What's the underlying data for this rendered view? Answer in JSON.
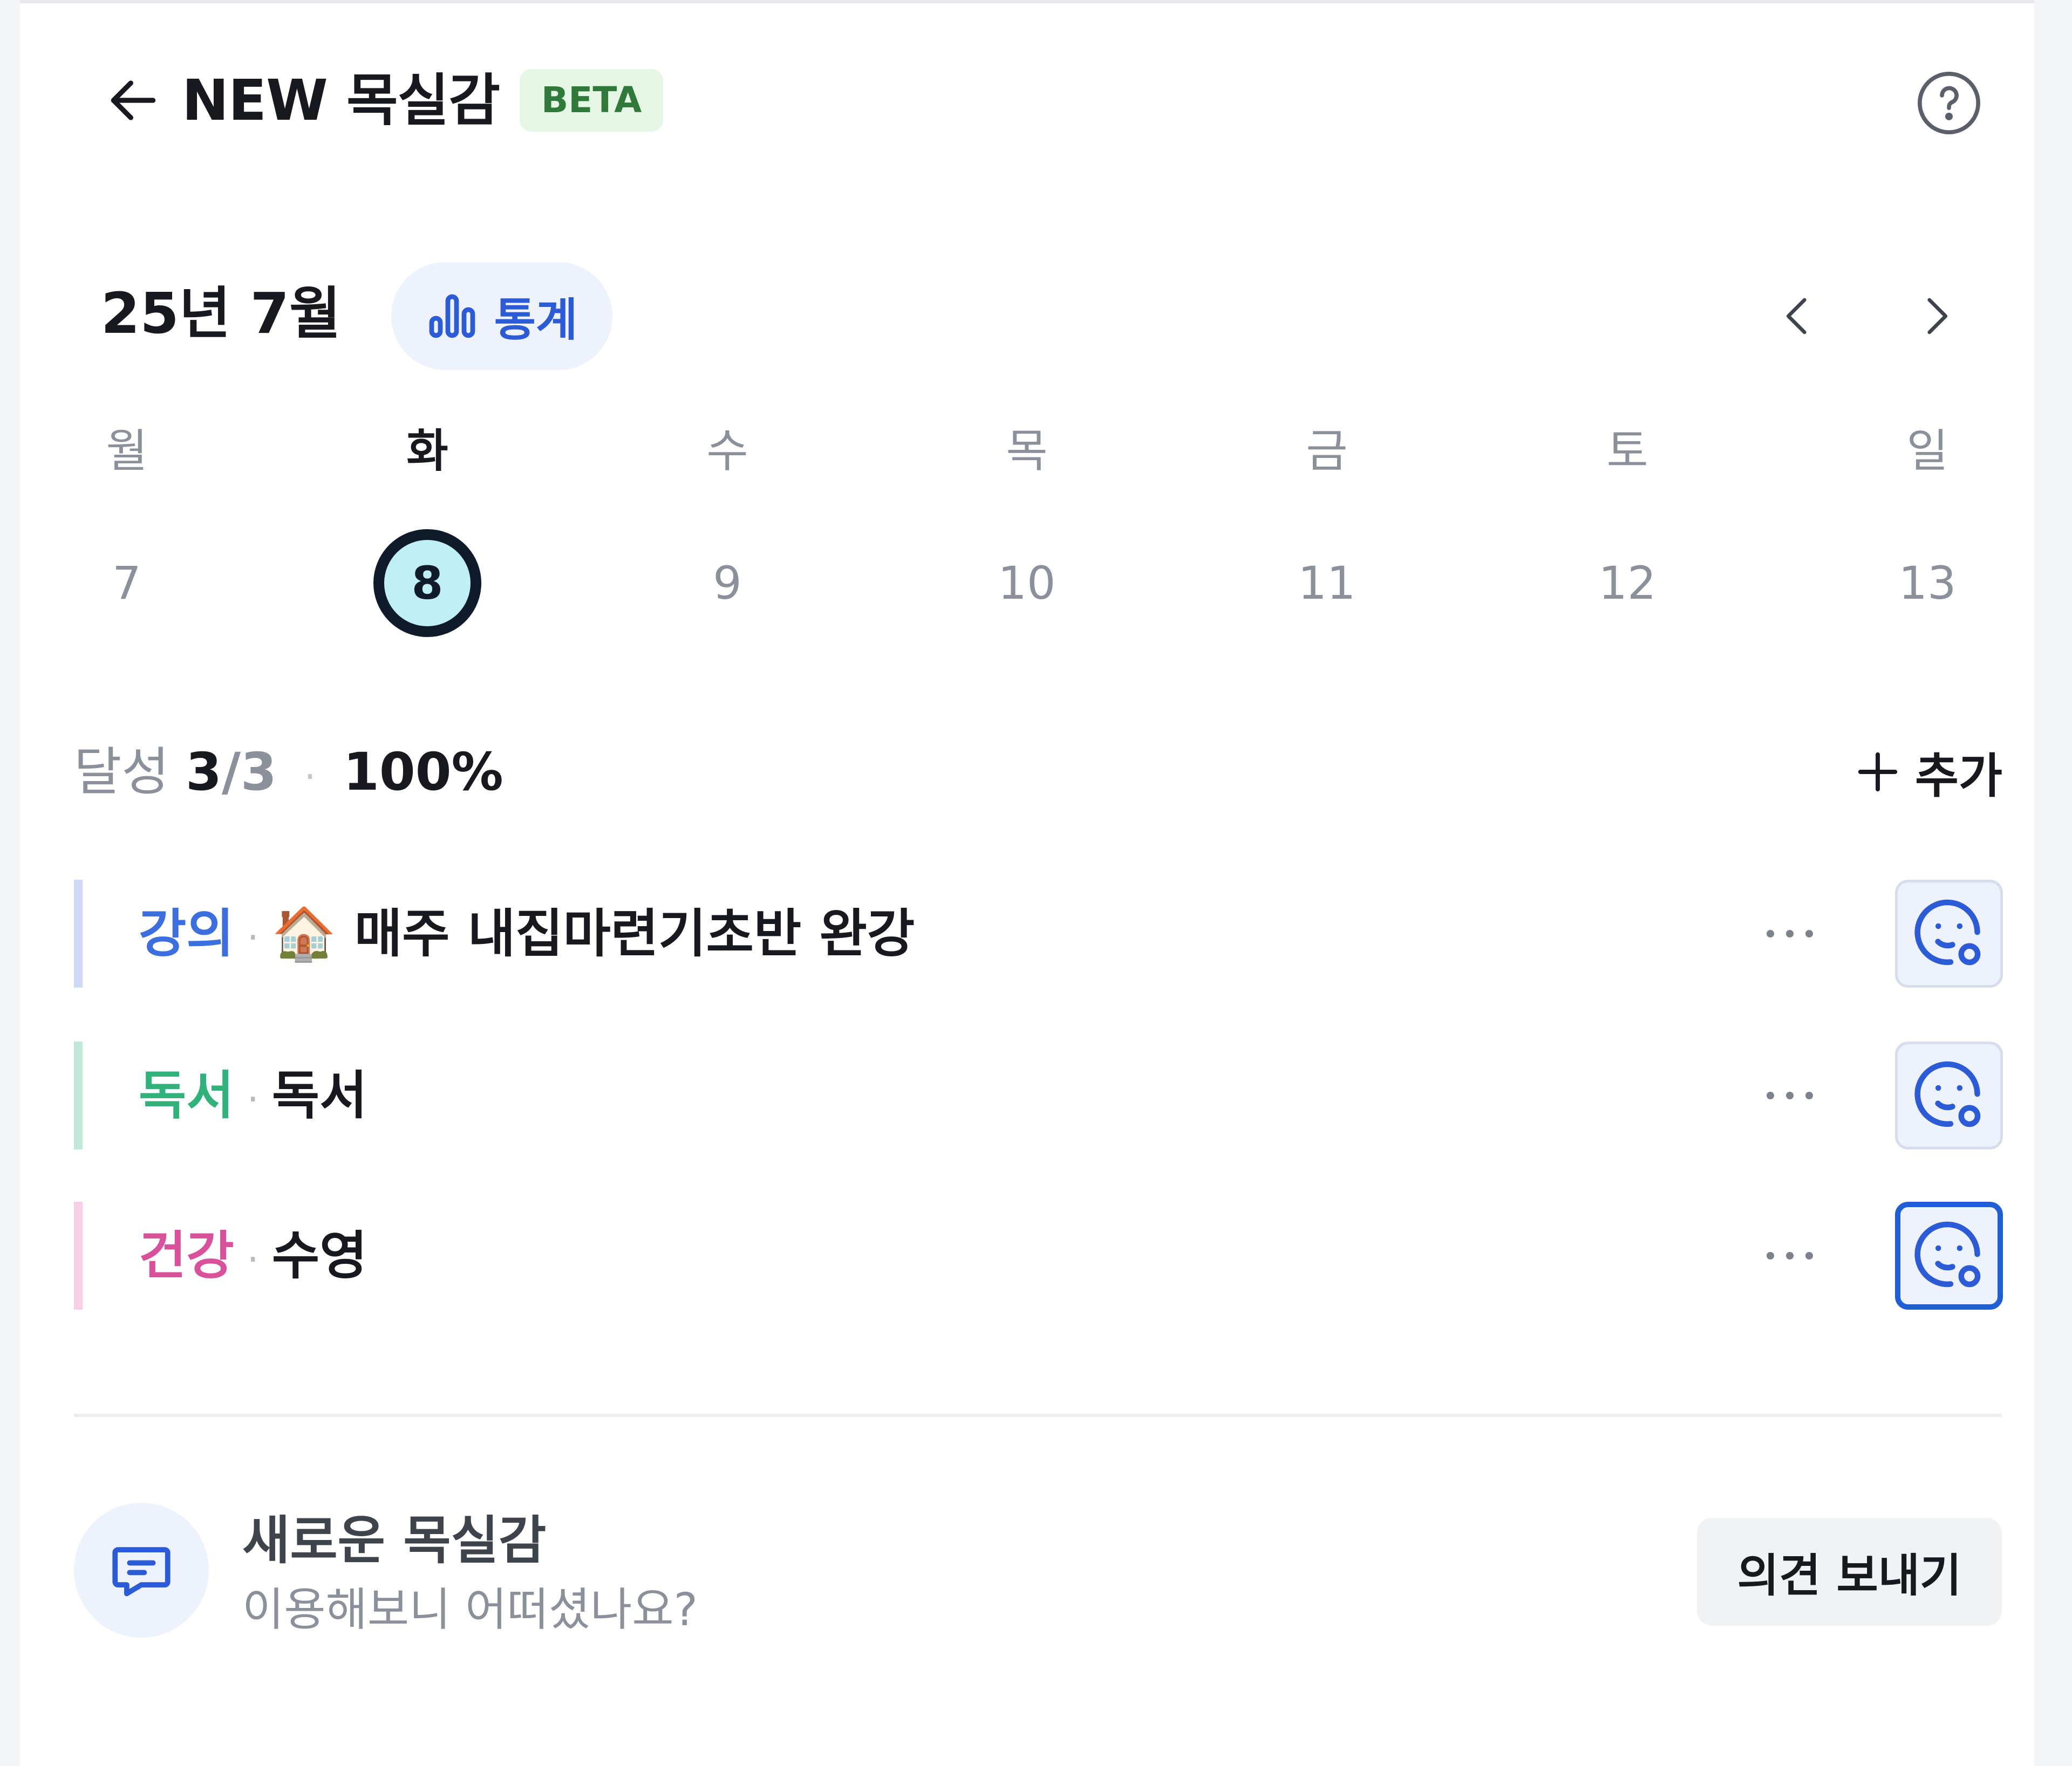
{
  "header": {
    "title": "NEW 목실감",
    "badge": "BETA"
  },
  "calendar": {
    "month_label": "25년 7월",
    "stats_label": "통계",
    "days": [
      {
        "name": "월",
        "num": "7",
        "selected": false
      },
      {
        "name": "화",
        "num": "8",
        "selected": true
      },
      {
        "name": "수",
        "num": "9",
        "selected": false
      },
      {
        "name": "목",
        "num": "10",
        "selected": false
      },
      {
        "name": "금",
        "num": "11",
        "selected": false
      },
      {
        "name": "토",
        "num": "12",
        "selected": false
      },
      {
        "name": "일",
        "num": "13",
        "selected": false
      }
    ]
  },
  "achievement": {
    "label": "달성",
    "count": "3",
    "total": "/3",
    "separator": "·",
    "percent": "100%"
  },
  "add_label": "추가",
  "goals": [
    {
      "category": "강의",
      "emoji": "🏠",
      "title": "매주 내집마련기초반 완강",
      "category_color": "#3b6fe0",
      "bar_color": "#cdd9f7"
    },
    {
      "category": "독서",
      "emoji": "",
      "title": "독서",
      "category_color": "#2fb37a",
      "bar_color": "#bfe9d6"
    },
    {
      "category": "건강",
      "emoji": "",
      "title": "수영",
      "category_color": "#d9509b",
      "bar_color": "#f8cfe6"
    }
  ],
  "goal_separator": "·",
  "feedback": {
    "title": "새로운 목실감",
    "subtitle": "이용해보니 어떠셨나요?",
    "button": "의견 보내기"
  },
  "colors": {
    "accent": "#1f5fd6",
    "selected_day_fill": "#bff0f7"
  }
}
